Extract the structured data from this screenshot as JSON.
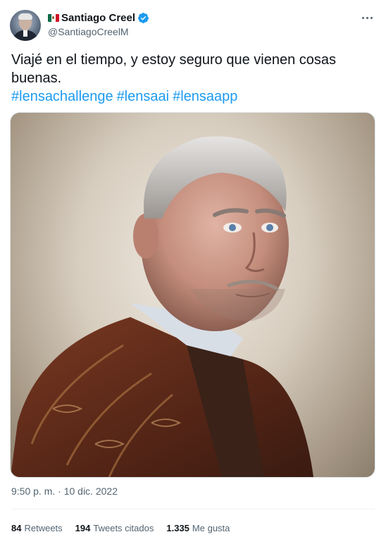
{
  "author": {
    "display_name": "Santiago Creel",
    "handle": "@SantiagoCreelM",
    "flag": "mexico-flag-emoji",
    "verified_icon": "verified-badge-icon",
    "verified_color": "#1d9bf0"
  },
  "tweet": {
    "text": "Viajé en el tiempo, y estoy seguro que vienen cosas buenas.",
    "hashtags": [
      "#lensachallenge",
      "#lensaai",
      "#lensaapp"
    ],
    "hashtag_color": "#1d9bf0",
    "timestamp": "9:50 p. m. · 10 dic. 2022"
  },
  "stats": {
    "retweets_count": "84",
    "retweets_label": "Retweets",
    "quotes_count": "194",
    "quotes_label": "Tweets citados",
    "likes_count": "1.335",
    "likes_label": "Me gusta"
  },
  "icons": {
    "more": "more-options-icon"
  }
}
